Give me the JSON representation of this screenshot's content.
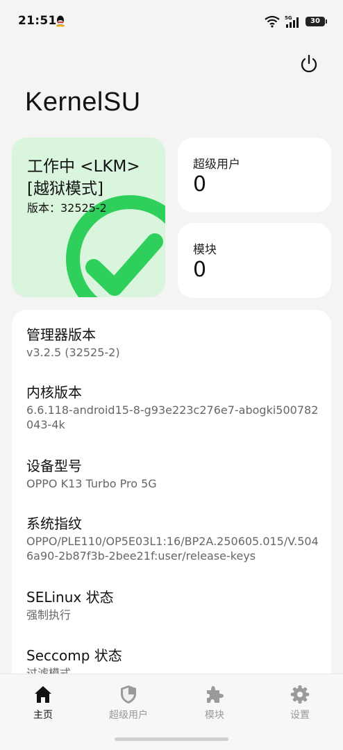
{
  "status_bar": {
    "time": "21:51",
    "network": "5G",
    "battery": "30"
  },
  "app": {
    "title": "KernelSU"
  },
  "status_card": {
    "line1": "工作中 <LKM>",
    "line2": "[越狱模式]",
    "version": "版本：32525-2",
    "color": "#2fcf5c"
  },
  "superuser_card": {
    "label": "超级用户",
    "count": "0"
  },
  "module_card": {
    "label": "模块",
    "count": "0"
  },
  "info": [
    {
      "title": "管理器版本",
      "value": "v3.2.5 (32525-2)"
    },
    {
      "title": "内核版本",
      "value": "6.6.118-android15-8-g93e223c276e7-abogki500782043-4k"
    },
    {
      "title": "设备型号",
      "value": "OPPO K13 Turbo Pro 5G"
    },
    {
      "title": "系统指纹",
      "value": "OPPO/PLE110/OP5E03L1:16/BP2A.250605.015/V.5046a90-2b87f3b-2bee21f:user/release-keys"
    },
    {
      "title": "SELinux 状态",
      "value": "强制执行"
    },
    {
      "title": "Seccomp 状态",
      "value": "过滤模式"
    }
  ],
  "nav": [
    {
      "label": "主页",
      "icon": "home-icon",
      "active": true
    },
    {
      "label": "超级用户",
      "icon": "shield-icon",
      "active": false
    },
    {
      "label": "模块",
      "icon": "puzzle-icon",
      "active": false
    },
    {
      "label": "设置",
      "icon": "gear-icon",
      "active": false
    }
  ]
}
